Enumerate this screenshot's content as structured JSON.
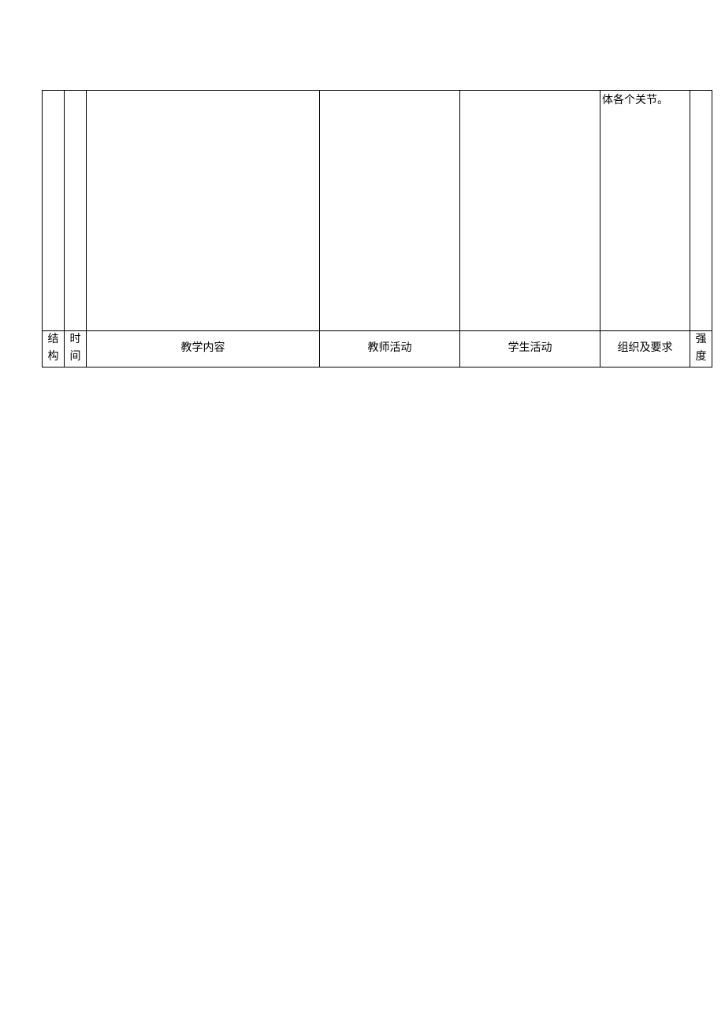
{
  "row_body": {
    "note_col5": "体各个关节。"
  },
  "headers": {
    "col0_c1": "结",
    "col0_c2": "构",
    "col1_c1": "时",
    "col1_c2": "间",
    "col2": "教学内容",
    "col3": "教师活动",
    "col4": "学生活动",
    "col5": "组织及要求",
    "col6": "强度"
  }
}
